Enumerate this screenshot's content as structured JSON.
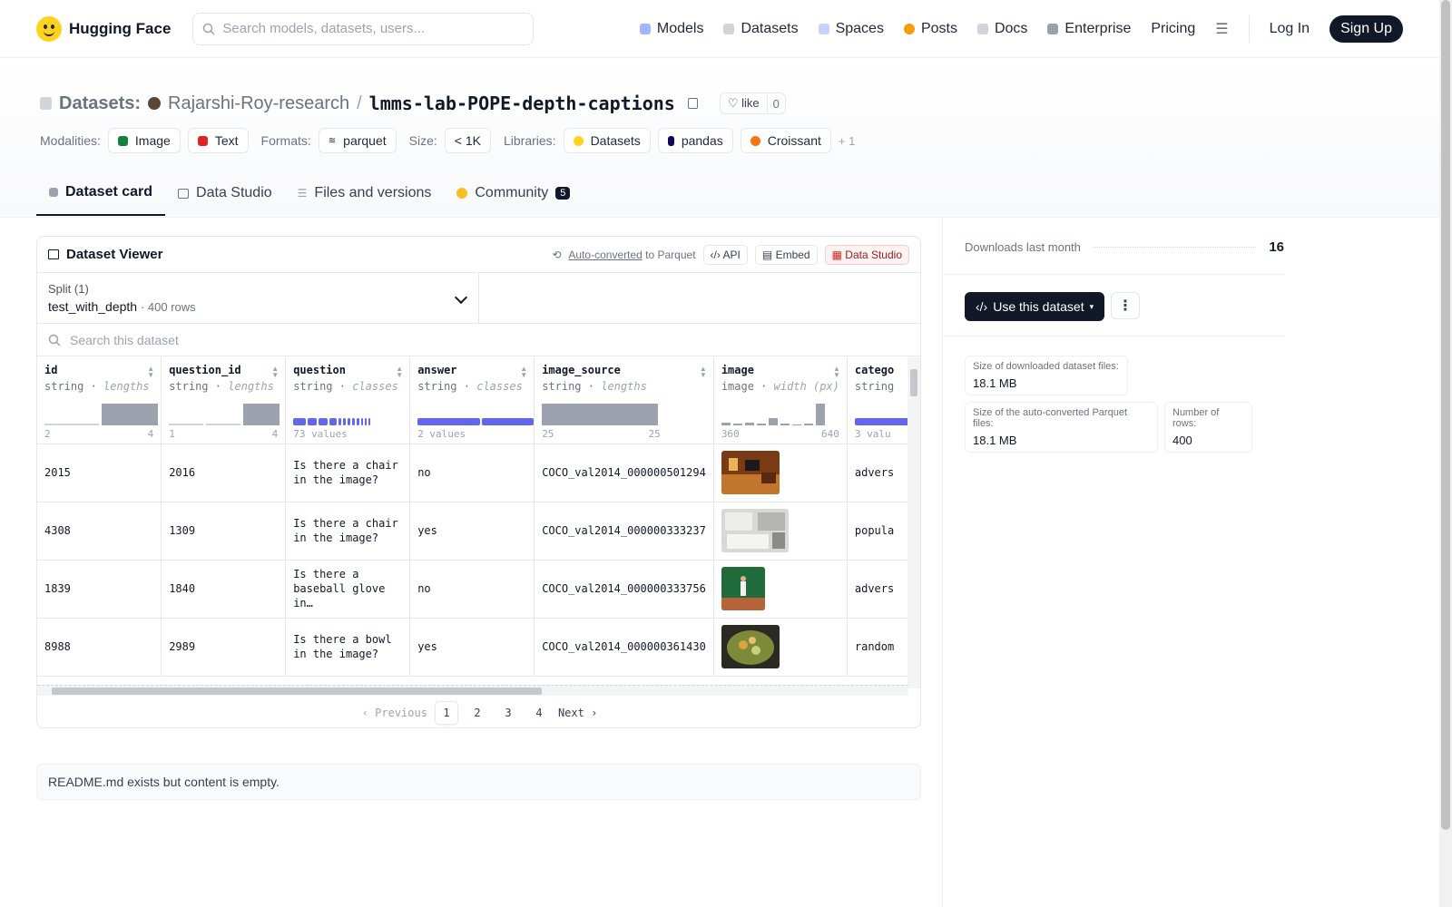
{
  "nav": {
    "brand": "Hugging Face",
    "search_placeholder": "Search models, datasets, users...",
    "links": [
      "Models",
      "Datasets",
      "Spaces",
      "Posts",
      "Docs",
      "Enterprise",
      "Pricing"
    ],
    "login": "Log In",
    "signup": "Sign Up"
  },
  "header": {
    "label": "Datasets:",
    "owner": "Rajarshi-Roy-research",
    "separator": "/",
    "name": "lmms-lab-POPE-depth-captions",
    "like_label": "like",
    "like_count": "0",
    "modalities_key": "Modalities:",
    "modalities": [
      "Image",
      "Text"
    ],
    "formats_key": "Formats:",
    "format": "parquet",
    "size_key": "Size:",
    "size": "< 1K",
    "libraries_key": "Libraries:",
    "libraries": [
      "Datasets",
      "pandas",
      "Croissant"
    ],
    "more_libraries": "+ 1"
  },
  "tabs": [
    {
      "label": "Dataset card"
    },
    {
      "label": "Data Studio"
    },
    {
      "label": "Files and versions"
    },
    {
      "label": "Community",
      "badge": "5"
    }
  ],
  "viewer": {
    "title": "Dataset Viewer",
    "auto_converted": "Auto-converted",
    "to_parquet": "to Parquet",
    "api": "API",
    "embed": "Embed",
    "data_studio": "Data Studio",
    "split_label": "Split (1)",
    "split_value": "test_with_depth",
    "split_rows": "400 rows",
    "search_placeholder": "Search this dataset",
    "columns": [
      {
        "name": "id",
        "type": "string",
        "stat": "lengths",
        "min": "2",
        "max": "4"
      },
      {
        "name": "question_id",
        "type": "string",
        "stat": "lengths",
        "min": "1",
        "max": "4"
      },
      {
        "name": "question",
        "type": "string",
        "stat": "classes",
        "summary": "73 values"
      },
      {
        "name": "answer",
        "type": "string",
        "stat": "classes",
        "summary": "2 values"
      },
      {
        "name": "image_source",
        "type": "string",
        "stat": "lengths",
        "min": "25",
        "max": "25"
      },
      {
        "name": "image",
        "type": "image",
        "stat": "width (px)",
        "min": "360",
        "max": "640"
      },
      {
        "name": "catego",
        "type": "string",
        "summary": "3 valu"
      }
    ],
    "rows": [
      {
        "id": "2015",
        "question_id": "2016",
        "question": "Is there a chair in the image?",
        "answer": "no",
        "image_source": "COCO_val2014_000000501294",
        "category": "advers"
      },
      {
        "id": "4308",
        "question_id": "1309",
        "question": "Is there a chair in the image?",
        "answer": "yes",
        "image_source": "COCO_val2014_000000333237",
        "category": "popula"
      },
      {
        "id": "1839",
        "question_id": "1840",
        "question": "Is there a baseball glove in…",
        "answer": "no",
        "image_source": "COCO_val2014_000000333756",
        "category": "advers"
      },
      {
        "id": "8988",
        "question_id": "2989",
        "question": "Is there a bowl in the image?",
        "answer": "yes",
        "image_source": "COCO_val2014_000000361430",
        "category": "random"
      }
    ],
    "pagination": {
      "previous": "Previous",
      "pages": [
        "1",
        "2",
        "3",
        "4"
      ],
      "current": "1",
      "next": "Next"
    }
  },
  "readme": "README.md exists but content is empty.",
  "sidebar": {
    "downloads_label": "Downloads last month",
    "downloads_value": "16",
    "use_button": "Use this dataset",
    "size_files_label": "Size of downloaded dataset files:",
    "size_files_value": "18.1 MB",
    "size_parquet_label": "Size of the auto-converted Parquet files:",
    "size_parquet_value": "18.1 MB",
    "rows_label": "Number of rows:",
    "rows_value": "400"
  },
  "colors": {
    "accent_dark": "#111827",
    "class_bar": "#6366f1",
    "hist_bar": "#9ca3af"
  }
}
